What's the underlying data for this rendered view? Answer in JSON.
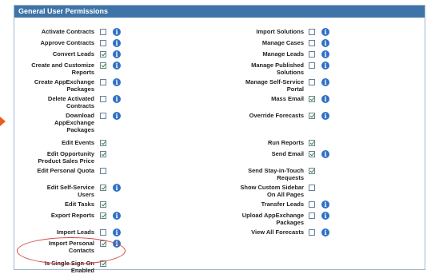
{
  "panel": {
    "title": "General User Permissions"
  },
  "icons": {
    "info": "info-icon",
    "pointer": "arrow-right-icon"
  },
  "left": [
    {
      "label": "Activate Contracts",
      "checked": false,
      "info": true
    },
    {
      "label": "Approve Contracts",
      "checked": false,
      "info": true
    },
    {
      "label": "Convert Leads",
      "checked": true,
      "info": true
    },
    {
      "label": "Create and Customize\nReports",
      "checked": true,
      "info": true
    },
    {
      "label": "Create AppExchange\nPackages",
      "checked": false,
      "info": true
    },
    {
      "label": "Delete Activated\nContracts",
      "checked": false,
      "info": true
    },
    {
      "label": "Download\nAppExchange\nPackages",
      "checked": false,
      "info": true
    },
    {
      "label": "Edit Events",
      "checked": true,
      "info": false
    },
    {
      "label": "Edit Opportunity\nProduct Sales Price",
      "checked": true,
      "info": false
    },
    {
      "label": "Edit Personal Quota",
      "checked": false,
      "info": false
    },
    {
      "label": "Edit Self-Service\nUsers",
      "checked": true,
      "info": true
    },
    {
      "label": "Edit Tasks",
      "checked": true,
      "info": false
    },
    {
      "label": "Export Reports",
      "checked": true,
      "info": true
    },
    {
      "label": "Import Leads",
      "checked": false,
      "info": true
    },
    {
      "label": "Import Personal\nContacts",
      "checked": true,
      "info": true
    },
    {
      "label": "Is Single Sign-On\nEnabled",
      "checked": true,
      "info": false
    }
  ],
  "right": [
    {
      "label": "Import Solutions",
      "checked": false,
      "info": true
    },
    {
      "label": "Manage Cases",
      "checked": false,
      "info": true
    },
    {
      "label": "Manage Leads",
      "checked": false,
      "info": true
    },
    {
      "label": "Manage Published\nSolutions",
      "checked": false,
      "info": true
    },
    {
      "label": "Manage Self-Service\nPortal",
      "checked": false,
      "info": true
    },
    {
      "label": "Mass Email",
      "checked": true,
      "info": true
    },
    {
      "label": "Override Forecasts",
      "checked": true,
      "info": true
    },
    {
      "label": "Run Reports",
      "checked": true,
      "info": false
    },
    {
      "label": "Send Email",
      "checked": true,
      "info": true
    },
    {
      "label": "Send Stay-in-Touch\nRequests",
      "checked": true,
      "info": false
    },
    {
      "label": "Show Custom Sidebar\nOn All Pages",
      "checked": false,
      "info": false
    },
    {
      "label": "Transfer Leads",
      "checked": false,
      "info": true
    },
    {
      "label": "Upload AppExchange\nPackages",
      "checked": false,
      "info": true
    },
    {
      "label": "View All Forecasts",
      "checked": false,
      "info": true
    }
  ]
}
